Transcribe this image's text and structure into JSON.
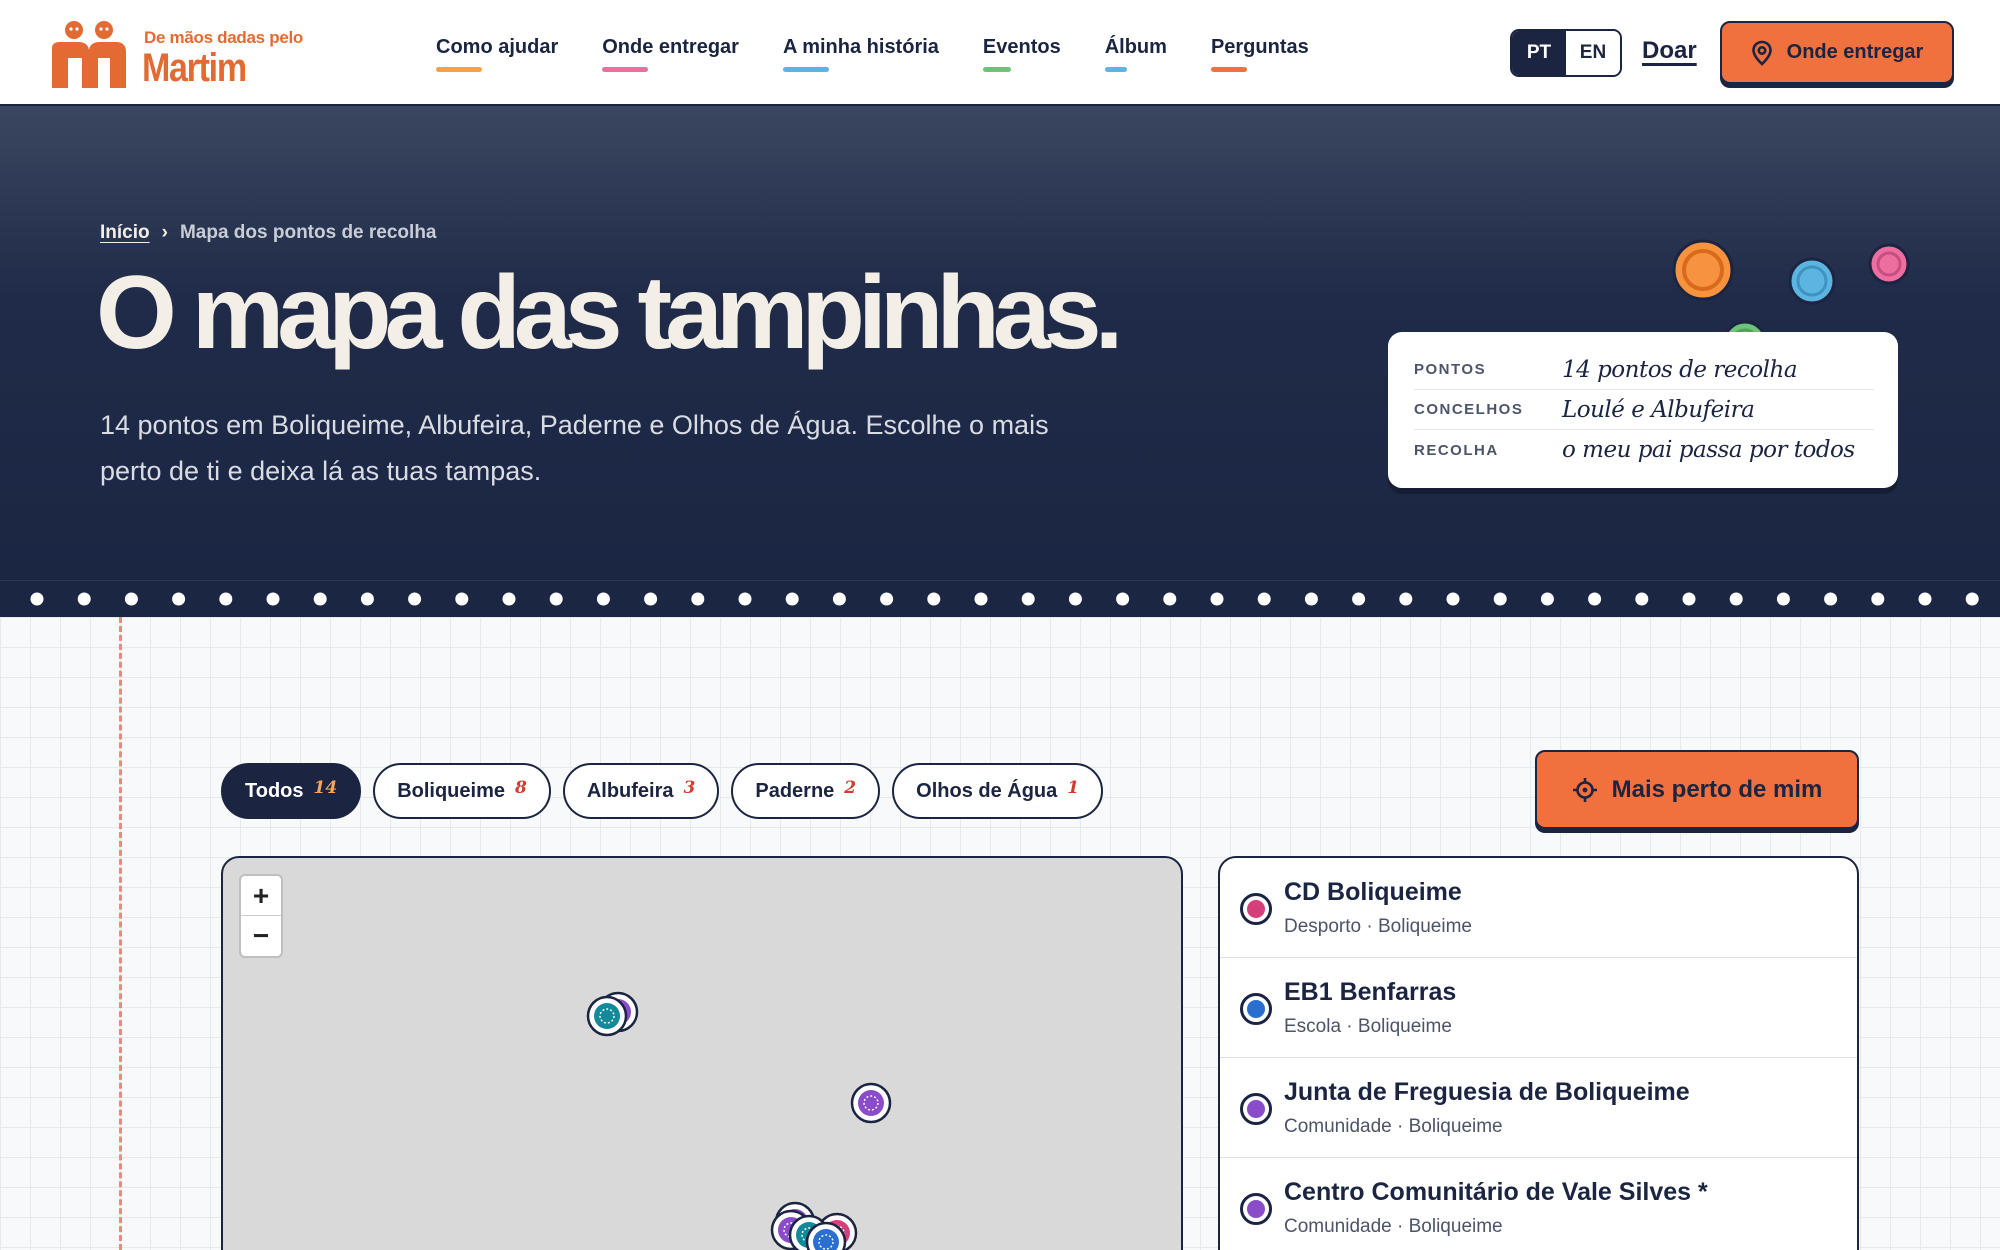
{
  "brand": {
    "tagline": "De mãos dadas pelo",
    "name": "Martim"
  },
  "nav": {
    "items": [
      {
        "label": "Como ajudar",
        "color": "#f7a045"
      },
      {
        "label": "Onde entregar",
        "color": "#ec6fa0"
      },
      {
        "label": "A minha história",
        "color": "#5cb4e0"
      },
      {
        "label": "Eventos",
        "color": "#6cc47a"
      },
      {
        "label": "Álbum",
        "color": "#5cb4e0"
      },
      {
        "label": "Perguntas",
        "color": "#f0703e"
      }
    ],
    "lang_active": "PT",
    "lang_other": "EN",
    "donate": "Doar",
    "cta": "Onde entregar"
  },
  "hero": {
    "breadcrumb_home": "Início",
    "breadcrumb_sep": "›",
    "breadcrumb_current": "Mapa dos pontos de recolha",
    "title": "O mapa das tampinhas.",
    "subtitle": "14 pontos em Boliqueime, Albufeira, Paderne e Olhos de Água. Escolhe o mais perto de ti e deixa lá as tuas tampas.",
    "info": [
      {
        "key": "PONTOS",
        "value": "14 pontos de recolha"
      },
      {
        "key": "CONCELHOS",
        "value": "Loulé e Albufeira"
      },
      {
        "key": "RECOLHA",
        "value": "o meu pai passa por todos"
      }
    ]
  },
  "filters": [
    {
      "label": "Todos",
      "count": "14",
      "active": true
    },
    {
      "label": "Boliqueime",
      "count": "8"
    },
    {
      "label": "Albufeira",
      "count": "3"
    },
    {
      "label": "Paderne",
      "count": "2"
    },
    {
      "label": "Olhos de Água",
      "count": "1"
    }
  ],
  "near_button": "Mais perto de mim",
  "map": {
    "zoom_in": "+",
    "zoom_out": "−"
  },
  "points": [
    {
      "name": "CD Boliqueime",
      "meta": "Desporto · Boliqueime",
      "color": "#d6407a"
    },
    {
      "name": "EB1 Benfarras",
      "meta": "Escola · Boliqueime",
      "color": "#2a6fd0"
    },
    {
      "name": "Junta de Freguesia de Boliqueime",
      "meta": "Comunidade · Boliqueime",
      "color": "#8a4cc8"
    },
    {
      "name": "Centro Comunitário de Vale Silves *",
      "meta": "Comunidade · Boliqueime",
      "color": "#8a4cc8"
    }
  ],
  "colors": {
    "navy": "#1b2440",
    "orange": "#f0703e",
    "cream": "#f4efe6"
  }
}
